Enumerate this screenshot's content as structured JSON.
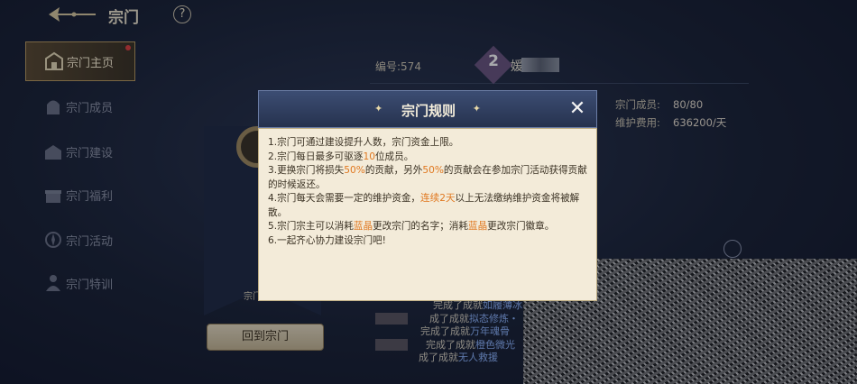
{
  "header": {
    "title": "宗门",
    "help": "?"
  },
  "sidebar": {
    "items": [
      {
        "label": "宗门主页",
        "active": true,
        "badge": true
      },
      {
        "label": "宗门成员",
        "active": false
      },
      {
        "label": "宗门建设",
        "active": false
      },
      {
        "label": "宗门福利",
        "active": false
      },
      {
        "label": "宗门活动",
        "active": false
      },
      {
        "label": "宗门特训",
        "active": false
      }
    ]
  },
  "sect": {
    "number": "编号:574",
    "rank": "2",
    "name_initial": "媛",
    "members_label": "宗门成员:",
    "members_value": "80/80",
    "upkeep_label": "维护费用:",
    "upkeep_value": "636200/天",
    "emblem_caption": "宗门",
    "return_label": "回到宗门"
  },
  "log": [
    {
      "prefix": "完成了成就",
      "achievement": "如履薄冰"
    },
    {
      "prefix": "成了成就",
      "achievement": "拟态修炼・"
    },
    {
      "prefix": "完成了成就",
      "achievement": "万年魂骨"
    },
    {
      "prefix": "完成了成就",
      "achievement": "橙色微光"
    },
    {
      "prefix": "成了成就",
      "achievement": "无人救援"
    }
  ],
  "modal": {
    "title": "宗门规则",
    "close": "✕",
    "rules": [
      {
        "parts": [
          {
            "t": "1.宗门可通过建设提升人数，宗门资金上限。"
          }
        ]
      },
      {
        "parts": [
          {
            "t": "2.宗门每日最多可驱逐"
          },
          {
            "t": "10",
            "h": true
          },
          {
            "t": "位成员。"
          }
        ]
      },
      {
        "parts": [
          {
            "t": "3.更换宗门将损失"
          },
          {
            "t": "50%",
            "h": true
          },
          {
            "t": "的贡献，另外"
          },
          {
            "t": "50%",
            "h": true
          },
          {
            "t": "的贡献会在参加宗门活动获得贡献的时候返还。"
          }
        ]
      },
      {
        "parts": [
          {
            "t": "4.宗门每天会需要一定的维护资金，"
          },
          {
            "t": "连续2天",
            "h": true
          },
          {
            "t": "以上无法缴纳维护资金将被解散。"
          }
        ]
      },
      {
        "parts": [
          {
            "t": "5.宗门宗主可以消耗"
          },
          {
            "t": "蓝晶",
            "h": true
          },
          {
            "t": "更改宗门的名字；消耗"
          },
          {
            "t": "蓝晶",
            "h": true
          },
          {
            "t": "更改宗门徽章。"
          }
        ]
      },
      {
        "parts": [
          {
            "t": "6.一起齐心协力建设宗门吧!"
          }
        ]
      }
    ]
  },
  "colors": {
    "highlight": "#e07820",
    "modal_bg": "#f3ebd9",
    "header_bg": "#2e3b5c"
  }
}
